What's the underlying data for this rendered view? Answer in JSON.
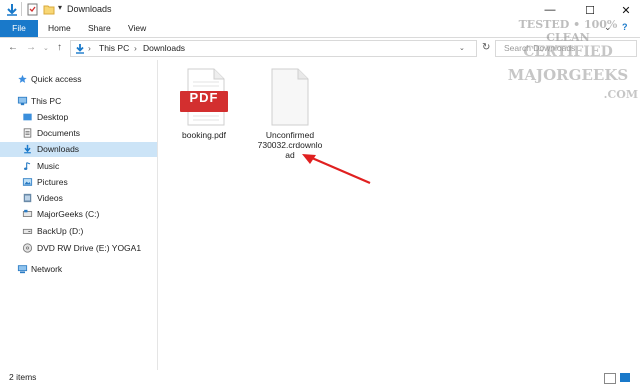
{
  "window": {
    "title": "Downloads"
  },
  "ribbon": {
    "tabs": [
      "File",
      "Home",
      "Share",
      "View"
    ]
  },
  "address": {
    "path": [
      "This PC",
      "Downloads"
    ],
    "search_placeholder": "Search Downloads"
  },
  "sidebar": {
    "items": [
      {
        "label": "Quick access",
        "icon": "star-icon"
      },
      {
        "label": "This PC",
        "icon": "computer-icon"
      },
      {
        "label": "Desktop",
        "icon": "desktop-folder-icon"
      },
      {
        "label": "Documents",
        "icon": "documents-icon"
      },
      {
        "label": "Downloads",
        "icon": "download-icon",
        "selected": true
      },
      {
        "label": "Music",
        "icon": "music-icon"
      },
      {
        "label": "Pictures",
        "icon": "pictures-icon"
      },
      {
        "label": "Videos",
        "icon": "videos-icon"
      },
      {
        "label": "MajorGeeks (C:)",
        "icon": "drive-icon"
      },
      {
        "label": "BackUp (D:)",
        "icon": "drive-icon"
      },
      {
        "label": "DVD RW Drive (E:) YOGA1",
        "icon": "dvd-icon"
      },
      {
        "label": "Network",
        "icon": "network-icon"
      }
    ]
  },
  "files": [
    {
      "name": "booking.pdf",
      "icon": "pdf-file-icon",
      "badge": "PDF"
    },
    {
      "name_lines": [
        "Unconfirmed",
        "730032.crdownlo",
        "ad"
      ],
      "icon": "blank-file-icon"
    }
  ],
  "status": {
    "item_count": "2 items"
  },
  "watermark": {
    "lines": [
      "TESTED • 100% CLEAN",
      "CERTIFIED",
      "MAJORGEEKS",
      ".COM"
    ]
  },
  "colors": {
    "accent": "#1979ca",
    "selected": "#cce4f7",
    "pdf_red": "#d32f2f",
    "arrow_red": "#e02020"
  }
}
